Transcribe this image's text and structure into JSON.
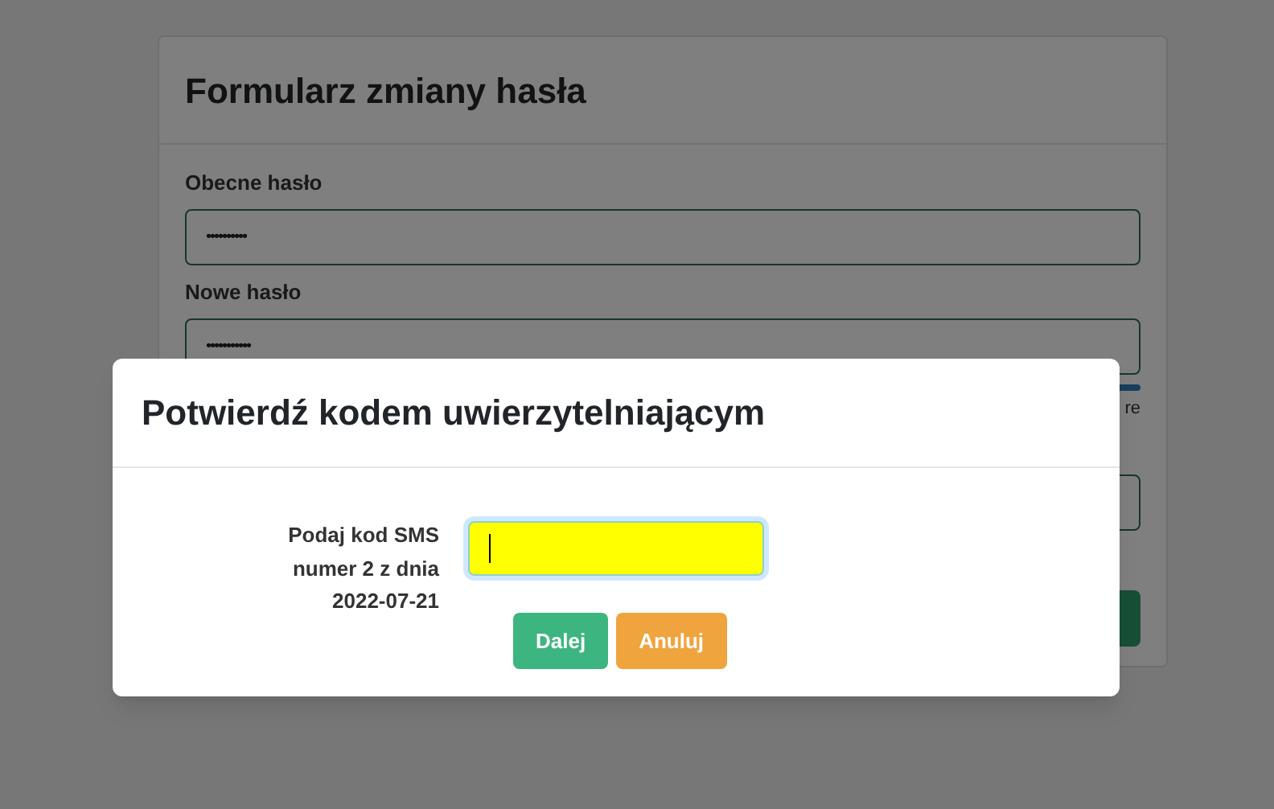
{
  "form": {
    "title": "Formularz zmiany hasła",
    "fields": [
      {
        "label": "Obecne hasło",
        "value": "••••••••••"
      },
      {
        "label": "Nowe hasło",
        "value": "•••••••••••"
      }
    ],
    "strength_hint": "re"
  },
  "dialog": {
    "title": "Potwierdź kodem uwierzytelniającym",
    "prompt": "Podaj kod SMS numer 2 z dnia 2022-07-21",
    "code_field": {
      "focused": true
    },
    "buttons": [
      {
        "label": "Dalej",
        "kind": "primary"
      },
      {
        "label": "Anuluj",
        "kind": "cancel"
      }
    ]
  }
}
